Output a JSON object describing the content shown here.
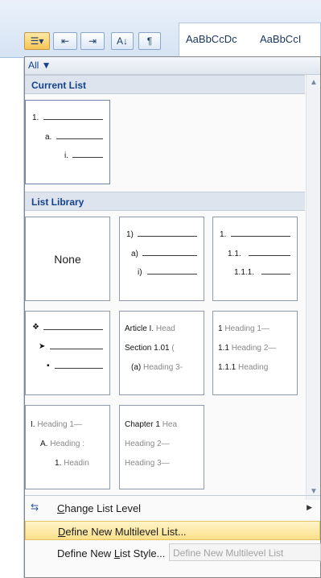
{
  "ribbon": {
    "style_gallery": [
      "AaBbCcDc",
      "AaBbCcI"
    ],
    "sort_label": "A↓",
    "pilcrow": "¶"
  },
  "menu": {
    "filter_label": "All ▼",
    "current_list": {
      "heading": "Current List",
      "levels": [
        "1.",
        "a.",
        "i."
      ]
    },
    "list_library": {
      "heading": "List Library",
      "none_label": "None",
      "tiles": [
        {
          "levels": [
            "1)",
            "a)",
            "i)"
          ]
        },
        {
          "levels": [
            "1.",
            "1.1.",
            "1.1.1."
          ]
        },
        {
          "levels": [
            "❖",
            "➤",
            "▪"
          ]
        },
        {
          "levels": [
            {
              "prefix": "Article I.",
              "text": "Head"
            },
            {
              "prefix": "Section 1.01",
              "text": "("
            },
            {
              "prefix": "(a)",
              "text": "Heading 3-"
            }
          ]
        },
        {
          "levels": [
            {
              "prefix": "1",
              "text": "Heading 1—"
            },
            {
              "prefix": "1.1",
              "text": "Heading 2—"
            },
            {
              "prefix": "1.1.1",
              "text": "Heading"
            }
          ]
        },
        {
          "levels": [
            {
              "prefix": "I.",
              "text": "Heading 1—"
            },
            {
              "prefix": "A.",
              "text": "Heading :"
            },
            {
              "prefix": "1.",
              "text": "Headin"
            }
          ]
        },
        {
          "levels": [
            {
              "prefix": "Chapter 1",
              "text": "Hea"
            },
            {
              "prefix": "",
              "text": "Heading 2—"
            },
            {
              "prefix": "",
              "text": "Heading 3—"
            }
          ]
        }
      ]
    },
    "commands": {
      "change_level": {
        "label_before": "",
        "accel": "C",
        "label_after": "hange List Level"
      },
      "define_multilevel": {
        "label_before": "",
        "accel": "D",
        "label_after": "efine New Multilevel List..."
      },
      "define_style": {
        "label_before": "Define New ",
        "accel": "L",
        "label_after": "ist Style..."
      }
    },
    "tooltip": "Define New Multilevel List"
  },
  "colors": {
    "accent": "#15428b",
    "highlight": "#fbe08a",
    "section_bg": "#dde4ee"
  }
}
